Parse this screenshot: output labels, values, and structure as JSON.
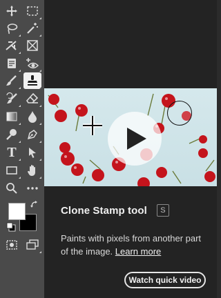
{
  "toolbar": {
    "tools": [
      {
        "name": "move-tool",
        "icon": "move-icon"
      },
      {
        "name": "marquee-tool",
        "icon": "marquee-icon"
      },
      {
        "name": "lasso-tool",
        "icon": "lasso-icon"
      },
      {
        "name": "magic-wand-tool",
        "icon": "magic-wand-icon"
      },
      {
        "name": "crop-tool",
        "icon": "crop-icon"
      },
      {
        "name": "frame-tool",
        "icon": "frame-icon"
      },
      {
        "name": "note-tool",
        "icon": "note-icon"
      },
      {
        "name": "red-eye-tool",
        "icon": "red-eye-icon"
      },
      {
        "name": "healing-brush-tool",
        "icon": "healing-brush-icon"
      },
      {
        "name": "clone-stamp-tool",
        "icon": "clone-stamp-icon",
        "active": true
      },
      {
        "name": "history-brush-tool",
        "icon": "history-brush-icon"
      },
      {
        "name": "eraser-tool",
        "icon": "eraser-icon"
      },
      {
        "name": "gradient-tool",
        "icon": "gradient-icon"
      },
      {
        "name": "blur-tool",
        "icon": "droplet-icon"
      },
      {
        "name": "dodge-tool",
        "icon": "dodge-icon"
      },
      {
        "name": "pen-tool",
        "icon": "pen-icon"
      },
      {
        "name": "type-tool",
        "icon": "type-icon"
      },
      {
        "name": "path-selection-tool",
        "icon": "arrow-icon"
      },
      {
        "name": "rectangle-tool",
        "icon": "rectangle-icon"
      },
      {
        "name": "hand-tool",
        "icon": "hand-icon"
      },
      {
        "name": "zoom-tool",
        "icon": "zoom-icon"
      },
      {
        "name": "more-tools",
        "icon": "more-icon"
      }
    ],
    "foreground_color": "#ffffff",
    "background_color": "#000000",
    "type_tool_glyph": "T"
  },
  "tooltip": {
    "title": "Clone Stamp tool",
    "shortcut": "S",
    "description": "Paints with pixels from another part of the image.",
    "learn_more": "Learn more",
    "watch_button": "Watch quick video",
    "accent": "#e6e6e6"
  }
}
